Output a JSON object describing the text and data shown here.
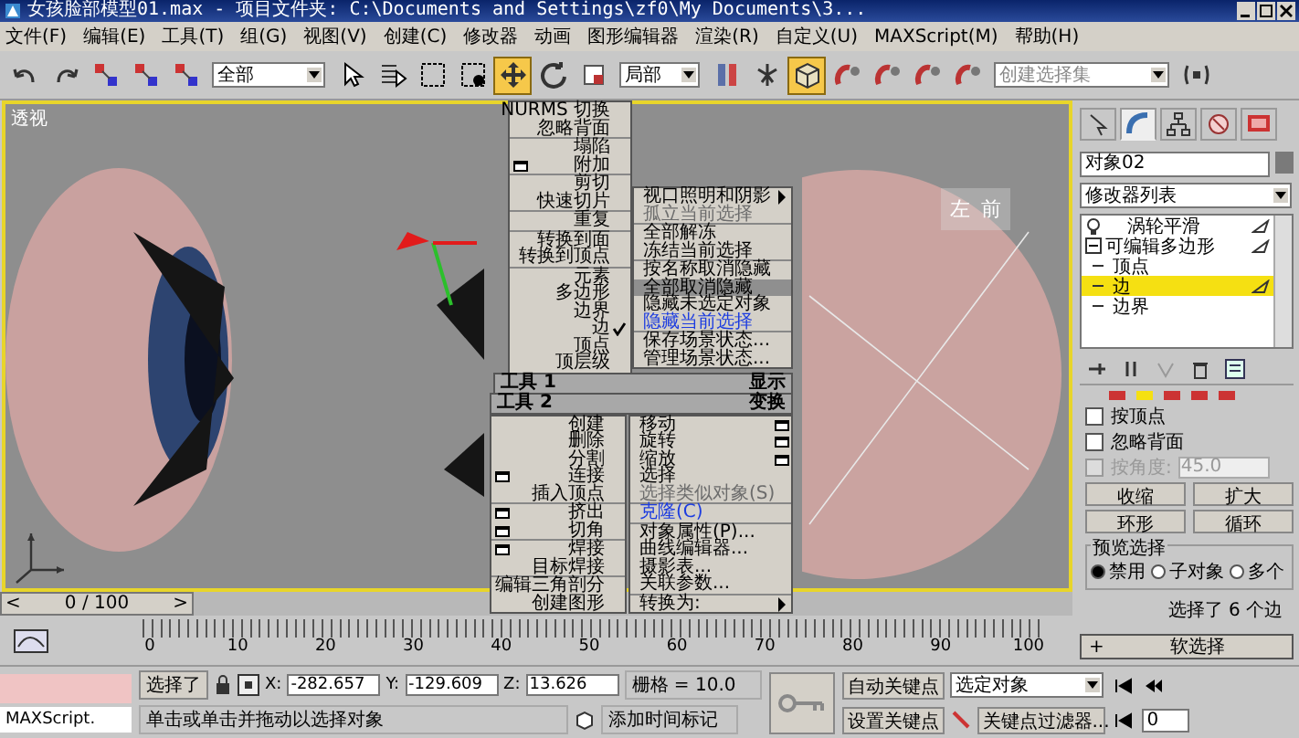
{
  "window": {
    "title": "女孩脸部模型01.max      - 项目文件夹: C:\\Documents and Settings\\zf0\\My Documents\\3..."
  },
  "menu": [
    "文件(F)",
    "编辑(E)",
    "工具(T)",
    "组(G)",
    "视图(V)",
    "创建(C)",
    "修改器",
    "动画",
    "图形编辑器",
    "渲染(R)",
    "自定义(U)",
    "MAXScript(M)",
    "帮助(H)"
  ],
  "toolbar": {
    "buttons": [
      {
        "selected": false
      },
      {
        "selected": false
      },
      {
        "selected": false
      },
      {
        "selected": false
      },
      {
        "selected": false
      },
      {
        "selected": false
      },
      {
        "selected": false
      },
      {
        "selected": false
      },
      {
        "selected": false
      },
      {
        "selected": true
      },
      {
        "selected": false
      },
      {
        "selected": false
      },
      {
        "selected": false
      },
      {
        "selected": false
      },
      {
        "selected": true
      },
      {
        "selected": false
      },
      {
        "selected": false
      },
      {
        "selected": false
      },
      {
        "selected": false
      },
      {
        "selected": false
      }
    ],
    "filter": "全部",
    "coordinate": "局部",
    "selection_set": {
      "placeholder": "创建选择集"
    }
  },
  "viewport": {
    "label": "透视",
    "view_cube": [
      "左",
      "前"
    ]
  },
  "quad_menu": {
    "top_left": [
      [
        {
          "label": "NURMS 切换",
          "kind": "plain",
          "selected": false
        },
        {
          "label": "忽略背面",
          "kind": "plain",
          "selected": false
        }
      ],
      [
        {
          "label": "塌陷",
          "kind": "plain",
          "selected": false
        },
        {
          "label": "附加",
          "kind": "settings",
          "selected": false
        }
      ],
      [
        {
          "label": "剪切",
          "kind": "plain",
          "selected": false
        },
        {
          "label": "快速切片",
          "kind": "plain",
          "selected": false
        }
      ],
      [
        {
          "label": "重复",
          "kind": "plain",
          "selected": false
        }
      ],
      [
        {
          "label": "转换到面",
          "kind": "plain",
          "selected": false
        },
        {
          "label": "转换到顶点",
          "kind": "plain",
          "selected": false
        }
      ],
      [
        {
          "label": "元素",
          "kind": "plain",
          "selected": false
        },
        {
          "label": "多边形",
          "kind": "plain",
          "selected": false
        },
        {
          "label": "边界",
          "kind": "plain",
          "selected": false
        },
        {
          "label": "边",
          "kind": "checked",
          "selected": false
        },
        {
          "label": "顶点",
          "kind": "plain",
          "selected": false
        },
        {
          "label": "顶层级",
          "kind": "plain",
          "selected": false
        }
      ]
    ],
    "top_right": [
      [
        {
          "label": "视口照明和阴影",
          "kind": "submenu",
          "selected": false
        },
        {
          "label": "孤立当前选择",
          "kind": "disabled",
          "selected": false
        }
      ],
      [
        {
          "label": "全部解冻",
          "kind": "plain",
          "selected": false
        },
        {
          "label": "冻结当前选择",
          "kind": "plain",
          "selected": false
        }
      ],
      [
        {
          "label": "按名称取消隐藏",
          "kind": "plain",
          "selected": false
        },
        {
          "label": "全部取消隐藏",
          "kind": "plain",
          "selected": true
        },
        {
          "label": "隐藏未选定对象",
          "kind": "plain",
          "selected": false
        },
        {
          "label": "隐藏当前选择",
          "kind": "recent",
          "selected": false
        }
      ],
      [
        {
          "label": "保存场景状态...",
          "kind": "plain",
          "selected": false
        },
        {
          "label": "管理场景状态...",
          "kind": "plain",
          "selected": false
        }
      ]
    ],
    "header_top": {
      "left": "工具 1",
      "right": "显示"
    },
    "header_bottom": {
      "left": "工具 2",
      "right": "变换"
    },
    "bottom_left": [
      [
        {
          "label": "创建",
          "kind": "plain",
          "selected": false
        },
        {
          "label": "删除",
          "kind": "plain",
          "selected": false
        },
        {
          "label": "分割",
          "kind": "plain",
          "selected": false
        },
        {
          "label": "连接",
          "kind": "settings",
          "selected": false
        },
        {
          "label": "插入顶点",
          "kind": "plain",
          "selected": false
        }
      ],
      [
        {
          "label": "挤出",
          "kind": "settings",
          "selected": false
        },
        {
          "label": "切角",
          "kind": "settings",
          "selected": false
        }
      ],
      [
        {
          "label": "焊接",
          "kind": "settings",
          "selected": false
        },
        {
          "label": "目标焊接",
          "kind": "plain",
          "selected": false
        }
      ],
      [
        {
          "label": "编辑三角剖分",
          "kind": "plain",
          "selected": false
        },
        {
          "label": "创建图形",
          "kind": "plain",
          "selected": false
        }
      ]
    ],
    "bottom_right": [
      [
        {
          "label": "移动",
          "kind": "settings",
          "selected": false
        },
        {
          "label": "旋转",
          "kind": "settings",
          "selected": false
        },
        {
          "label": "缩放",
          "kind": "settings",
          "selected": false
        },
        {
          "label": "选择",
          "kind": "plain",
          "selected": false
        },
        {
          "label": "选择类似对象(S)",
          "kind": "disabled",
          "selected": false
        }
      ],
      [
        {
          "label": "克隆(C)",
          "kind": "recent",
          "selected": false
        }
      ],
      [
        {
          "label": "对象属性(P)...",
          "kind": "plain",
          "selected": false
        },
        {
          "label": "曲线编辑器...",
          "kind": "plain",
          "selected": false
        },
        {
          "label": "摄影表...",
          "kind": "plain",
          "selected": false
        },
        {
          "label": "关联参数...",
          "kind": "plain",
          "selected": false
        }
      ],
      [
        {
          "label": "转换为:",
          "kind": "submenu",
          "selected": false
        }
      ]
    ]
  },
  "command_panel": {
    "tabs": [
      {
        "selected": false
      },
      {
        "selected": true
      },
      {
        "selected": false
      },
      {
        "selected": false
      },
      {
        "selected": false
      }
    ],
    "object_name": "对象02",
    "modifier_list": "修改器列表",
    "stack": [
      {
        "label": "涡轮平滑",
        "kind": "modifier"
      },
      {
        "label": "可编辑多边形",
        "kind": "base",
        "expanded": true,
        "children": [
          {
            "label": "顶点",
            "selected": false
          },
          {
            "label": "边",
            "selected": true
          },
          {
            "label": "边界",
            "selected": false
          }
        ]
      }
    ],
    "subobject_levels": [
      {
        "selected": false
      },
      {
        "selected": true
      },
      {
        "selected": false
      },
      {
        "selected": false
      },
      {
        "selected": false
      }
    ],
    "checkboxes": [
      {
        "label": "按顶点",
        "checked": false,
        "disabled": false
      },
      {
        "label": "忽略背面",
        "checked": false,
        "disabled": false
      },
      {
        "label": "按角度:",
        "checked": false,
        "disabled": true,
        "value": "45.0"
      }
    ],
    "buttons": [
      "收缩",
      "扩大"
    ],
    "spinner_buttons": [
      "环形",
      "循环"
    ],
    "preview": {
      "title": "预览选择",
      "options": [
        {
          "label": "禁用",
          "selected": true
        },
        {
          "label": "子对象",
          "selected": false
        },
        {
          "label": "多个",
          "selected": false
        }
      ]
    },
    "selection_info": "选择了 6 个边",
    "soft_rollout": {
      "sign": "+",
      "title": "软选择"
    }
  },
  "time_slider": {
    "prev": "<",
    "label": "0 / 100",
    "next": ">"
  },
  "track_ticks": [
    "0",
    "10",
    "20",
    "30",
    "40",
    "50",
    "60",
    "70",
    "80",
    "90",
    "100"
  ],
  "status": {
    "listener": "MAXScript.",
    "selection": "选择了",
    "coordinates": [
      {
        "axis": "X:",
        "value": "-282.657"
      },
      {
        "axis": "Y:",
        "value": "-129.609"
      },
      {
        "axis": "Z:",
        "value": "13.626"
      }
    ],
    "grid": "栅格 = 10.0",
    "prompt": "单击或单击并拖动以选择对象",
    "time_tag": "添加时间标记",
    "auto_key": "自动关键点",
    "set_key": "设置关键点",
    "key_mode": "选定对象",
    "key_filters": "关键点过滤器...",
    "frame": "0"
  }
}
